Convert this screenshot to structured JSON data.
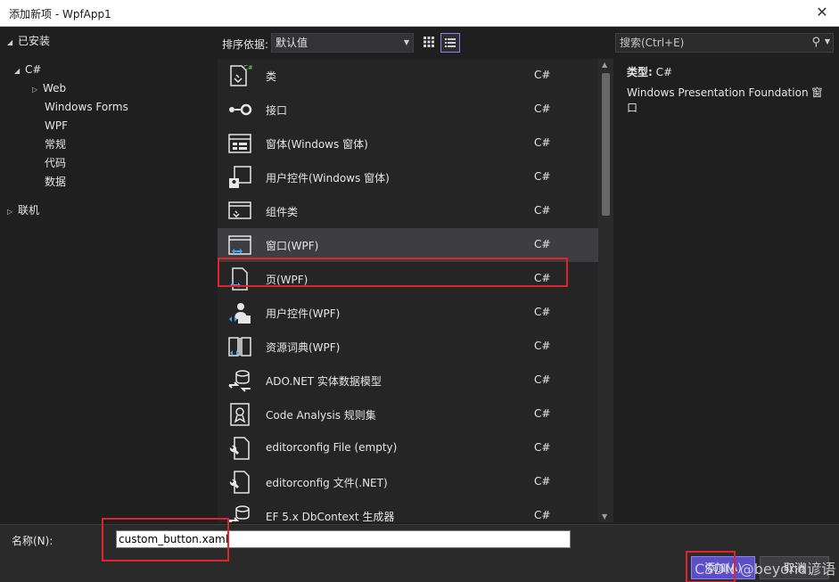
{
  "window": {
    "title": "添加新项 - WpfApp1",
    "close_glyph": "✕"
  },
  "tree": {
    "installed": "已安装",
    "lang": "C#",
    "children": [
      "Web",
      "Windows Forms",
      "WPF",
      "常规",
      "代码",
      "数据"
    ],
    "online": "联机"
  },
  "toolbar": {
    "sort_label": "排序依据:",
    "sort_value": "默认值",
    "search_placeholder": "搜索(Ctrl+E)"
  },
  "templates": [
    {
      "name": "类",
      "lang": "C#",
      "icon": "class-icon"
    },
    {
      "name": "接口",
      "lang": "C#",
      "icon": "interface-icon"
    },
    {
      "name": "窗体(Windows 窗体)",
      "lang": "C#",
      "icon": "form-icon"
    },
    {
      "name": "用户控件(Windows 窗体)",
      "lang": "C#",
      "icon": "user-control-icon"
    },
    {
      "name": "组件类",
      "lang": "C#",
      "icon": "component-icon"
    },
    {
      "name": "窗口(WPF)",
      "lang": "C#",
      "icon": "window-icon"
    },
    {
      "name": "页(WPF)",
      "lang": "C#",
      "icon": "page-icon"
    },
    {
      "name": "用户控件(WPF)",
      "lang": "C#",
      "icon": "user-control-wpf-icon"
    },
    {
      "name": "资源词典(WPF)",
      "lang": "C#",
      "icon": "resource-dictionary-icon"
    },
    {
      "name": "ADO.NET 实体数据模型",
      "lang": "C#",
      "icon": "data-model-icon"
    },
    {
      "name": "Code Analysis 规则集",
      "lang": "C#",
      "icon": "ruleset-icon"
    },
    {
      "name": "editorconfig File (empty)",
      "lang": "C#",
      "icon": "config-file-icon"
    },
    {
      "name": "editorconfig 文件(.NET)",
      "lang": "C#",
      "icon": "config-file-icon"
    },
    {
      "name": "EF 5.x DbContext 生成器",
      "lang": "C#",
      "icon": "generator-icon"
    }
  ],
  "details": {
    "type_label": "类型:",
    "type_value": "C#",
    "description": "Windows Presentation Foundation 窗口"
  },
  "bottom": {
    "name_label": "名称(N):",
    "name_value": "custom_button.xaml",
    "add_label": "添加(A)",
    "cancel_label": "取消",
    "watermark": "CSDN @beyond谚语"
  },
  "colors": {
    "accent": "#5b4ec9",
    "highlight": "#e0242f",
    "icon_blue": "#3fa9f5"
  }
}
